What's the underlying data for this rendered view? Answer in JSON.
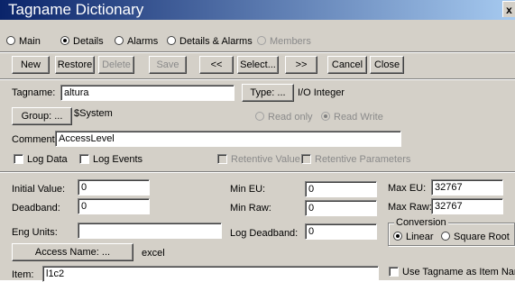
{
  "window": {
    "title": "Tagname Dictionary",
    "close_glyph": "x"
  },
  "view_options": [
    {
      "label": "Main",
      "checked": false,
      "enabled": true
    },
    {
      "label": "Details",
      "checked": true,
      "enabled": true
    },
    {
      "label": "Alarms",
      "checked": false,
      "enabled": true
    },
    {
      "label": "Details & Alarms",
      "checked": false,
      "enabled": true
    },
    {
      "label": "Members",
      "checked": false,
      "enabled": false
    }
  ],
  "toolbar": {
    "new": "New",
    "restore": "Restore",
    "delete": "Delete",
    "save": "Save",
    "prev": "<<",
    "select": "Select...",
    "next": ">>",
    "cancel": "Cancel",
    "close": "Close"
  },
  "tag": {
    "tagname_label": "Tagname:",
    "tagname_value": "altura",
    "type_button": "Type: ...",
    "type_value": "I/O Integer",
    "group_button": "Group: ...",
    "group_value": "$System",
    "read_only": "Read only",
    "read_write": "Read Write",
    "comment_label": "Comment:",
    "comment_value": "AccessLevel",
    "log_data": "Log Data",
    "log_events": "Log Events",
    "retentive_value": "Retentive Value",
    "retentive_params": "Retentive Parameters"
  },
  "details": {
    "initial_value_label": "Initial Value:",
    "initial_value": "0",
    "deadband_label": "Deadband:",
    "deadband": "0",
    "eng_units_label": "Eng Units:",
    "eng_units": "",
    "min_eu_label": "Min EU:",
    "min_eu": "0",
    "min_raw_label": "Min Raw:",
    "min_raw": "0",
    "log_deadband_label": "Log Deadband:",
    "log_deadband": "0",
    "max_eu_label": "Max EU:",
    "max_eu": "32767",
    "max_raw_label": "Max Raw:",
    "max_raw": "32767",
    "conversion_label": "Conversion",
    "linear": "Linear",
    "square_root": "Square Root",
    "access_name_button": "Access Name: ...",
    "access_name_value": "excel",
    "item_label": "Item:",
    "item_value": "l1c2",
    "use_tagname": "Use Tagname as Item Name"
  }
}
